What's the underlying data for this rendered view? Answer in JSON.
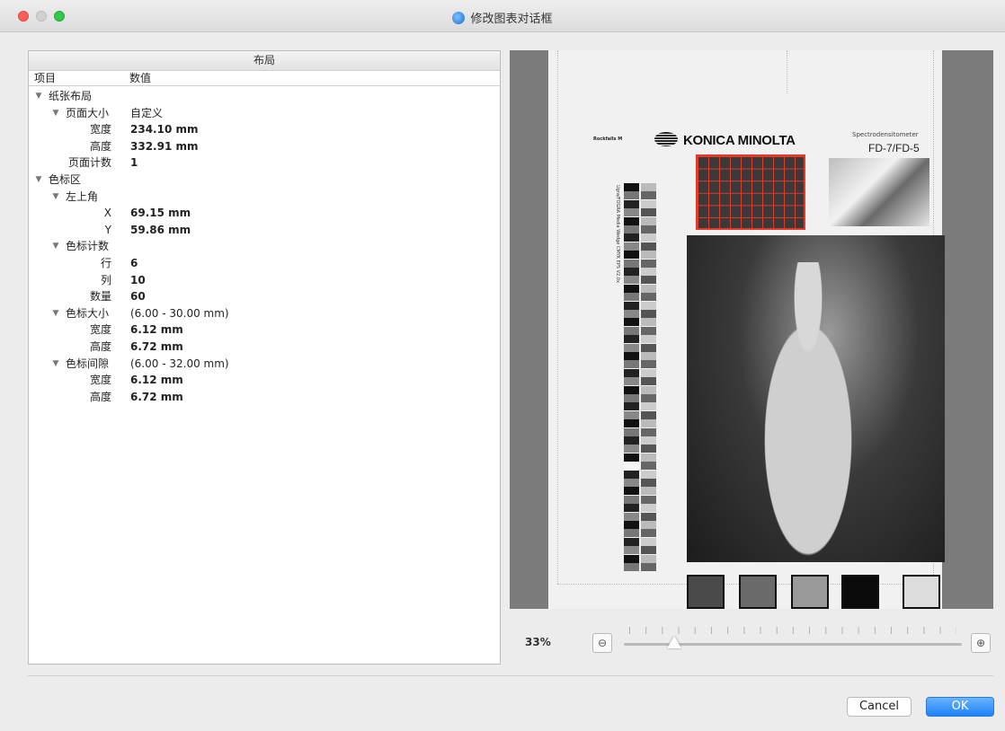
{
  "window": {
    "title": "修改图表对话框"
  },
  "layout_panel": {
    "title": "布局",
    "columns": [
      "项目",
      "数值"
    ],
    "rows": [
      {
        "level": 0,
        "expand": true,
        "label": "纸张布局",
        "value": ""
      },
      {
        "level": 1,
        "expand": true,
        "label": "页面大小",
        "value": "自定义"
      },
      {
        "level": 2,
        "expand": false,
        "label": "宽度",
        "value": "234.10 mm"
      },
      {
        "level": 2,
        "expand": false,
        "label": "高度",
        "value": "332.91 mm"
      },
      {
        "level": 2,
        "expand": false,
        "label": "页面计数",
        "value": "1"
      },
      {
        "level": 0,
        "expand": true,
        "label": "色标区",
        "value": ""
      },
      {
        "level": 1,
        "expand": true,
        "label": "左上角",
        "value": ""
      },
      {
        "level": 2,
        "expand": false,
        "label": "X",
        "value": "69.15 mm"
      },
      {
        "level": 2,
        "expand": false,
        "label": "Y",
        "value": "59.86 mm"
      },
      {
        "level": 1,
        "expand": true,
        "label": "色标计数",
        "value": ""
      },
      {
        "level": 2,
        "expand": false,
        "label": "行",
        "value": "6"
      },
      {
        "level": 2,
        "expand": false,
        "label": "列",
        "value": "10"
      },
      {
        "level": 2,
        "expand": false,
        "label": "数量",
        "value": "60"
      },
      {
        "level": 1,
        "expand": true,
        "label": "色标大小",
        "value": "(6.00 - 30.00 mm)"
      },
      {
        "level": 2,
        "expand": false,
        "label": "宽度",
        "value": "6.12 mm"
      },
      {
        "level": 2,
        "expand": false,
        "label": "高度",
        "value": "6.72 mm"
      },
      {
        "level": 1,
        "expand": true,
        "label": "色标间隙",
        "value": "(6.00 - 32.00 mm)"
      },
      {
        "level": 2,
        "expand": false,
        "label": "宽度",
        "value": "6.12 mm"
      },
      {
        "level": 2,
        "expand": false,
        "label": "高度",
        "value": "6.72 mm"
      }
    ]
  },
  "preview": {
    "brand_small": "Rockfalls M",
    "brand": "KONICA MINOLTA",
    "instrument": "Spectrodensitometer",
    "model": "FD-7/FD-5",
    "strip_label": "Ugra/FOGRA Media Wedge CMYK EPS V2.0x",
    "accent_color": "#e23b2b"
  },
  "zoom": {
    "percent": "33%",
    "level": 0.15,
    "zoom_out_icon": "zoom-out-icon",
    "zoom_in_icon": "zoom-in-icon"
  },
  "buttons": {
    "cancel": "Cancel",
    "ok": "OK"
  }
}
